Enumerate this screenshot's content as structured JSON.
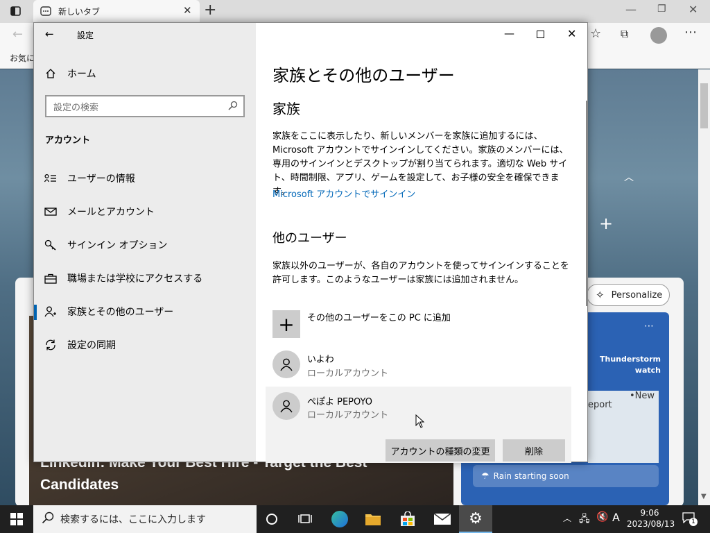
{
  "browser": {
    "tab_title": "新しいタブ",
    "favorites_label": "お気に",
    "personalize_label": "Personalize",
    "news_headline": "LinkedIn: Make Your Best Hire - Target the Best Candidates",
    "weather_alert": "Thunderstorm watch",
    "map_label_report": "eport",
    "map_label_new": "•New",
    "rain_text": "Rain starting soon"
  },
  "settings": {
    "window_title": "設定",
    "home_label": "ホーム",
    "search_placeholder": "設定の検索",
    "section_label": "アカウント",
    "nav": [
      {
        "label": "ユーザーの情報",
        "icon": "user-info-icon"
      },
      {
        "label": "メールとアカウント",
        "icon": "mail-icon"
      },
      {
        "label": "サインイン オプション",
        "icon": "key-icon"
      },
      {
        "label": "職場または学校にアクセスする",
        "icon": "briefcase-icon"
      },
      {
        "label": "家族とその他のユーザー",
        "icon": "family-user-icon"
      },
      {
        "label": "設定の同期",
        "icon": "sync-icon"
      }
    ],
    "page_title": "家族とその他のユーザー",
    "family_heading": "家族",
    "family_desc": "家族をここに表示したり、新しいメンバーを家族に追加するには、Microsoft アカウントでサインインしてください。家族のメンバーには、専用のサインインとデスクトップが割り当てられます。適切な Web サイト、時間制限、アプリ、ゲームを設定して、お子様の安全を確保できます。",
    "signin_link": "Microsoft アカウントでサインイン",
    "other_heading": "他のユーザー",
    "other_desc": "家族以外のユーザーが、各自のアカウントを使ってサインインすることを許可します。このようなユーザーは家族には追加されません。",
    "add_user_label": "その他のユーザーをこの PC に追加",
    "users": [
      {
        "name": "いよわ",
        "type": "ローカルアカウント"
      },
      {
        "name": "ぺぽよ PEPOYO",
        "type": "ローカルアカウント"
      }
    ],
    "change_type_button": "アカウントの種類の変更",
    "delete_button": "削除"
  },
  "taskbar": {
    "search_placeholder": "検索するには、ここに入力します",
    "ime_label": "A",
    "time": "9:06",
    "date": "2023/08/13",
    "notification_count": "1"
  },
  "colors": {
    "accent": "#0063b1",
    "link": "#0067b8",
    "taskbar": "#202020",
    "weather": "#2b62b4"
  }
}
